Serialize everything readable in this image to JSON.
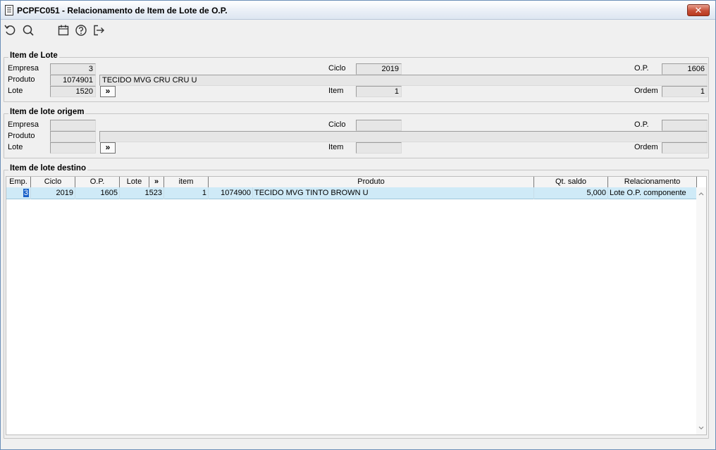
{
  "window": {
    "title": "PCPFC051 - Relacionamento de Item de Lote de O.P.",
    "close_label": "✕"
  },
  "toolbar": {
    "icons": [
      "undo-icon",
      "search-icon",
      "calendar-icon",
      "help-icon",
      "exit-icon"
    ]
  },
  "item_lote": {
    "legend": "Item de Lote",
    "empresa_label": "Empresa",
    "empresa": "3",
    "ciclo_label": "Ciclo",
    "ciclo": "2019",
    "op_label": "O.P.",
    "op": "1606",
    "produto_label": "Produto",
    "produto_code": "1074901",
    "produto_desc": "TECIDO MVG CRU CRU U",
    "lote_label": "Lote",
    "lote": "1520",
    "arrow": "»",
    "item_label": "Item",
    "item": "1",
    "ordem_label": "Ordem",
    "ordem": "1"
  },
  "item_origem": {
    "legend": "Item de lote origem",
    "empresa_label": "Empresa",
    "empresa": "",
    "ciclo_label": "Ciclo",
    "ciclo": "",
    "op_label": "O.P.",
    "op": "",
    "produto_label": "Produto",
    "produto_code": "",
    "produto_desc": "",
    "lote_label": "Lote",
    "lote": "",
    "arrow": "»",
    "item_label": "Item",
    "item": "",
    "ordem_label": "Ordem",
    "ordem": ""
  },
  "item_destino": {
    "legend": "Item de lote destino",
    "columns": [
      "Emp.",
      "Ciclo",
      "O.P.",
      "Lote",
      "»",
      "item",
      "Produto",
      "Qt. saldo",
      "Relacionamento"
    ],
    "rows": [
      {
        "emp": "3",
        "ciclo": "2019",
        "op": "1605",
        "lote": "1523",
        "item": "1",
        "produto_code": "1074900",
        "produto_desc": "TECIDO MVG TINTO BROWN U",
        "qt_saldo": "5,000",
        "relacionamento": "Lote O.P. componente"
      }
    ]
  }
}
